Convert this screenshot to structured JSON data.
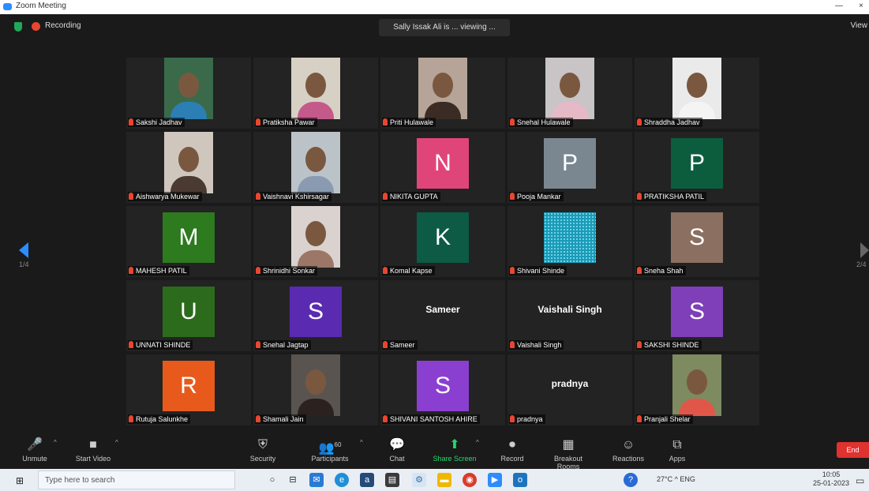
{
  "titlebar": {
    "title": "Zoom Meeting",
    "minimize": "—",
    "close": "×"
  },
  "meeting": {
    "recording_label": "Recording",
    "share_banner": "Sally Issak Ali is ... viewing ...",
    "view_label": "View",
    "page_left": "1/4",
    "page_right": "2/4"
  },
  "colors": {
    "zoom_blue": "#2d8cff",
    "share_green": "#23d96c",
    "end_red": "#e0322f",
    "muted_red": "#e8462e"
  },
  "participants": [
    {
      "name": "Sakshi Jadhav",
      "kind": "video",
      "bg": "#3a6a4a",
      "body": "#2b7fb5"
    },
    {
      "name": "Pratiksha Pawar",
      "kind": "video",
      "bg": "#d7d0c4",
      "body": "#c45a8a"
    },
    {
      "name": "Priti Hulawale",
      "kind": "video",
      "bg": "#b5a497",
      "body": "#3a2c24"
    },
    {
      "name": "Snehal Hulawale",
      "kind": "video",
      "bg": "#c9c4c6",
      "body": "#e6b9c6"
    },
    {
      "name": "Shraddha Jadhav",
      "kind": "video",
      "bg": "#eaeaea",
      "body": "#f4f4f4"
    },
    {
      "name": "Aishwarya Mukewar",
      "kind": "video",
      "bg": "#cfc7bd",
      "body": "#4a3a32"
    },
    {
      "name": "Vaishnavi Kshirsagar",
      "kind": "video",
      "bg": "#bcc3c8",
      "body": "#8a9bb1"
    },
    {
      "name": "NIKITA GUPTA",
      "kind": "avatar",
      "letter": "N",
      "color": "#e0457a"
    },
    {
      "name": "Pooja Mankar",
      "kind": "avatar",
      "letter": "P",
      "color": "#7b8790"
    },
    {
      "name": "PRATIKSHA PATIL",
      "kind": "avatar",
      "letter": "P",
      "color": "#0c5d3e"
    },
    {
      "name": "MAHESH PATIL",
      "kind": "avatar",
      "letter": "M",
      "color": "#2d7a1f"
    },
    {
      "name": "Shrinidhi Sonkar",
      "kind": "video",
      "bg": "#d9d2ce",
      "body": "#9c7767"
    },
    {
      "name": "Komal Kapse",
      "kind": "avatar",
      "letter": "K",
      "color": "#0d5a45"
    },
    {
      "name": "Shivani Shinde",
      "kind": "glitter",
      "color": "#1a9bb8"
    },
    {
      "name": "Sneha Shah",
      "kind": "avatar",
      "letter": "S",
      "color": "#8b6f61"
    },
    {
      "name": "UNNATI SHINDE",
      "kind": "avatar",
      "letter": "U",
      "color": "#2d6b1c"
    },
    {
      "name": "Snehal Jagtap",
      "kind": "avatar",
      "letter": "S",
      "color": "#5a2bb0"
    },
    {
      "name": "Sameer",
      "kind": "text",
      "center": "Sameer"
    },
    {
      "name": "Vaishali Singh",
      "kind": "text",
      "center": "Vaishali Singh"
    },
    {
      "name": "SAKSHI SHINDE",
      "kind": "avatar",
      "letter": "S",
      "color": "#7e3fb8"
    },
    {
      "name": "Rutuja Salunkhe",
      "kind": "avatar",
      "letter": "R",
      "color": "#e85a1b"
    },
    {
      "name": "Shamali Jain",
      "kind": "video",
      "bg": "#5a5450",
      "body": "#2b2220"
    },
    {
      "name": "SHIVANI SANTOSH AHIRE",
      "kind": "avatar",
      "letter": "S",
      "color": "#8a3fd1"
    },
    {
      "name": "pradnya",
      "kind": "text",
      "center": "pradnya"
    },
    {
      "name": "Pranjali Shelar",
      "kind": "video",
      "bg": "#7e8a60",
      "body": "#e0574a"
    }
  ],
  "controls": {
    "unmute": "Unmute",
    "start_video": "Start Video",
    "security": "Security",
    "participants": "Participants",
    "participants_count": "60",
    "chat": "Chat",
    "share_screen": "Share Screen",
    "record": "Record",
    "breakout_rooms": "Breakout Rooms",
    "reactions": "Reactions",
    "apps": "Apps",
    "end": "End"
  },
  "taskbar": {
    "search_placeholder": "Type here to search",
    "tray_text": "27°C  ^  ENG",
    "time": "10:05",
    "date": "25-01-2023"
  }
}
